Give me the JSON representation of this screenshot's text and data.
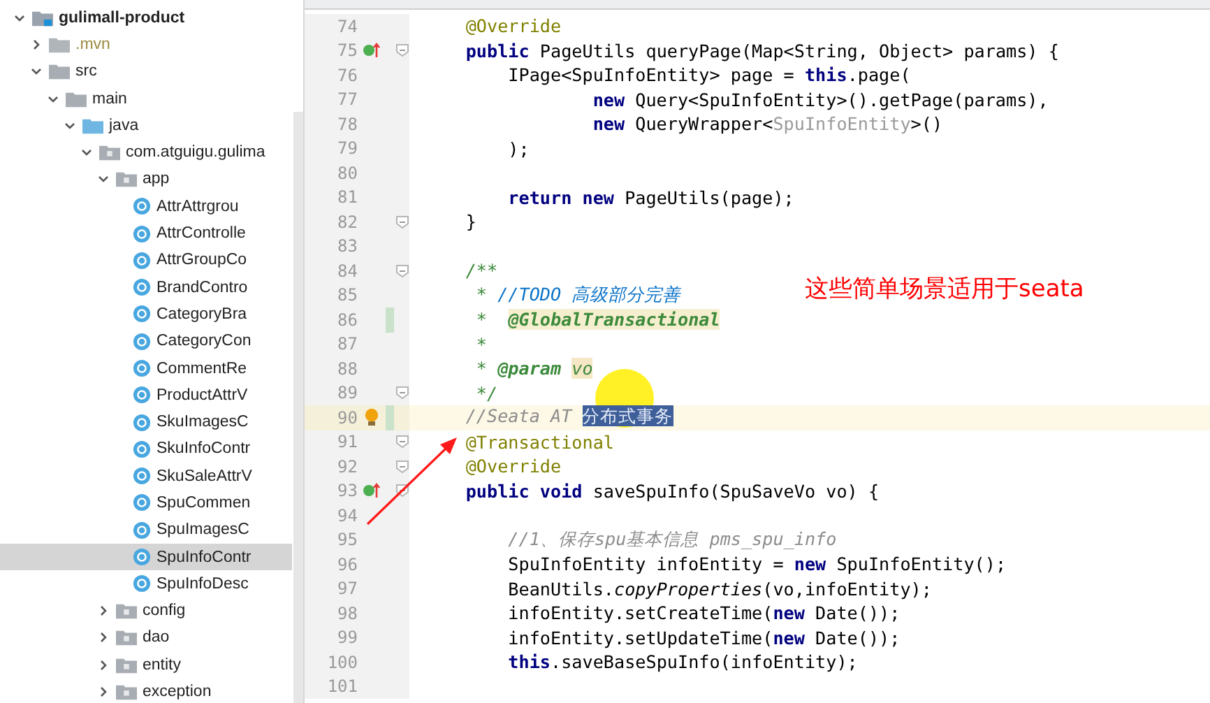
{
  "project_tree": {
    "items": [
      {
        "label": "gulimall-product",
        "kind": "module",
        "expanded": true,
        "selected": false,
        "children": [
          {
            "label": ".mvn",
            "kind": "excluded",
            "expanded": false,
            "selected": false
          },
          {
            "label": "src",
            "kind": "folder",
            "expanded": true,
            "selected": false,
            "children": [
              {
                "label": "main",
                "kind": "folder",
                "expanded": true,
                "selected": false,
                "children": [
                  {
                    "label": "java",
                    "kind": "source",
                    "expanded": true,
                    "selected": false,
                    "children": [
                      {
                        "label": "com.atguigu.gulima",
                        "kind": "package",
                        "expanded": true,
                        "selected": false,
                        "children": [
                          {
                            "label": "app",
                            "kind": "package",
                            "expanded": true,
                            "selected": false,
                            "children": [
                              {
                                "label": "AttrAttrgrou",
                                "kind": "class",
                                "selected": false
                              },
                              {
                                "label": "AttrControlle",
                                "kind": "class",
                                "selected": false
                              },
                              {
                                "label": "AttrGroupCo",
                                "kind": "class",
                                "selected": false
                              },
                              {
                                "label": "BrandContro",
                                "kind": "class",
                                "selected": false
                              },
                              {
                                "label": "CategoryBra",
                                "kind": "class",
                                "selected": false
                              },
                              {
                                "label": "CategoryCon",
                                "kind": "class",
                                "selected": false
                              },
                              {
                                "label": "CommentRe",
                                "kind": "class",
                                "selected": false
                              },
                              {
                                "label": "ProductAttrV",
                                "kind": "class",
                                "selected": false
                              },
                              {
                                "label": "SkuImagesC",
                                "kind": "class",
                                "selected": false
                              },
                              {
                                "label": "SkuInfoContr",
                                "kind": "class",
                                "selected": false
                              },
                              {
                                "label": "SkuSaleAttrV",
                                "kind": "class",
                                "selected": false
                              },
                              {
                                "label": "SpuCommen",
                                "kind": "class",
                                "selected": false
                              },
                              {
                                "label": "SpuImagesC",
                                "kind": "class",
                                "selected": false
                              },
                              {
                                "label": "SpuInfoContr",
                                "kind": "class",
                                "selected": true
                              },
                              {
                                "label": "SpuInfoDesc",
                                "kind": "class",
                                "selected": false
                              }
                            ]
                          },
                          {
                            "label": "config",
                            "kind": "package",
                            "expanded": false,
                            "selected": false
                          },
                          {
                            "label": "dao",
                            "kind": "package",
                            "expanded": false,
                            "selected": false
                          },
                          {
                            "label": "entity",
                            "kind": "package",
                            "expanded": false,
                            "selected": false
                          },
                          {
                            "label": "exception",
                            "kind": "package",
                            "expanded": false,
                            "selected": false
                          }
                        ]
                      }
                    ]
                  }
                ]
              }
            ]
          }
        ]
      }
    ]
  },
  "editor": {
    "lines": [
      {
        "number": "74",
        "overrides": false,
        "hint": false,
        "fold": false,
        "changed": false,
        "current": false,
        "tokens": [
          {
            "text": "    @Override",
            "kind": "annotation"
          }
        ]
      },
      {
        "number": "75",
        "overrides": true,
        "hint": false,
        "fold": true,
        "changed": false,
        "current": false,
        "tokens": [
          {
            "text": "    public",
            "kind": "keyword"
          },
          {
            "text": " PageUtils queryPage(Map<String, Object> params) {",
            "kind": "plain"
          }
        ]
      },
      {
        "number": "76",
        "overrides": false,
        "hint": false,
        "fold": false,
        "changed": false,
        "current": false,
        "tokens": [
          {
            "text": "        IPage<SpuInfoEntity> page = ",
            "kind": "plain"
          },
          {
            "text": "this",
            "kind": "keyword"
          },
          {
            "text": ".page(",
            "kind": "plain"
          }
        ]
      },
      {
        "number": "77",
        "overrides": false,
        "hint": false,
        "fold": false,
        "changed": false,
        "current": false,
        "tokens": [
          {
            "text": "                new",
            "kind": "keyword"
          },
          {
            "text": " Query<SpuInfoEntity>().getPage(params),",
            "kind": "plain"
          }
        ]
      },
      {
        "number": "78",
        "overrides": false,
        "hint": false,
        "fold": false,
        "changed": false,
        "current": false,
        "tokens": [
          {
            "text": "                new",
            "kind": "keyword"
          },
          {
            "text": " QueryWrapper<",
            "kind": "plain"
          },
          {
            "text": "SpuInfoEntity",
            "kind": "generic"
          },
          {
            "text": ">()",
            "kind": "plain"
          }
        ]
      },
      {
        "number": "79",
        "overrides": false,
        "hint": false,
        "fold": false,
        "changed": false,
        "current": false,
        "tokens": [
          {
            "text": "        );",
            "kind": "plain"
          }
        ]
      },
      {
        "number": "80",
        "overrides": false,
        "hint": false,
        "fold": false,
        "changed": false,
        "current": false
      },
      {
        "number": "81",
        "overrides": false,
        "hint": false,
        "fold": false,
        "changed": false,
        "current": false,
        "tokens": [
          {
            "text": "        return new",
            "kind": "keyword"
          },
          {
            "text": " PageUtils(page);",
            "kind": "plain"
          }
        ]
      },
      {
        "number": "82",
        "overrides": false,
        "hint": false,
        "fold": true,
        "changed": false,
        "current": false,
        "tokens": [
          {
            "text": "    }",
            "kind": "plain"
          }
        ]
      },
      {
        "number": "83",
        "overrides": false,
        "hint": false,
        "fold": false,
        "changed": false,
        "current": false
      },
      {
        "number": "84",
        "overrides": false,
        "hint": false,
        "fold": true,
        "changed": false,
        "current": false,
        "tokens": [
          {
            "text": "    /**",
            "kind": "doc"
          }
        ]
      },
      {
        "number": "85",
        "overrides": false,
        "hint": false,
        "fold": false,
        "changed": false,
        "current": false,
        "tokens": [
          {
            "text": "     * ",
            "kind": "doc"
          },
          {
            "text": "//TODO 高级部分完善",
            "kind": "todo"
          }
        ]
      },
      {
        "number": "86",
        "overrides": false,
        "hint": false,
        "fold": false,
        "changed": true,
        "current": false,
        "tokens": [
          {
            "text": "     *  ",
            "kind": "doc"
          },
          {
            "text": "@GlobalTransactional",
            "kind": "doc-marked"
          }
        ]
      },
      {
        "number": "87",
        "overrides": false,
        "hint": false,
        "fold": false,
        "changed": false,
        "current": false,
        "tokens": [
          {
            "text": "     *",
            "kind": "doc"
          }
        ]
      },
      {
        "number": "88",
        "overrides": false,
        "hint": false,
        "fold": false,
        "changed": false,
        "current": false,
        "tokens": [
          {
            "text": "     * ",
            "kind": "doc"
          },
          {
            "text": "@param ",
            "kind": "doc-tag"
          },
          {
            "text": "vo",
            "kind": "doc-value"
          }
        ]
      },
      {
        "number": "89",
        "overrides": false,
        "hint": false,
        "fold": true,
        "changed": false,
        "current": false,
        "tokens": [
          {
            "text": "     */",
            "kind": "doc"
          }
        ]
      },
      {
        "number": "90",
        "overrides": false,
        "hint": true,
        "fold": false,
        "changed": true,
        "current": true,
        "tokens": [
          {
            "text": "    //Seata AT ",
            "kind": "comment"
          },
          {
            "text": "分布式事务",
            "kind": "selected"
          }
        ]
      },
      {
        "number": "91",
        "overrides": false,
        "hint": false,
        "fold": true,
        "changed": false,
        "current": false,
        "tokens": [
          {
            "text": "    @Transactional",
            "kind": "annotation"
          }
        ]
      },
      {
        "number": "92",
        "overrides": false,
        "hint": false,
        "fold": true,
        "changed": false,
        "current": false,
        "tokens": [
          {
            "text": "    @Override",
            "kind": "annotation"
          }
        ]
      },
      {
        "number": "93",
        "overrides": true,
        "hint": false,
        "fold": true,
        "changed": false,
        "current": false,
        "tokens": [
          {
            "text": "    public void",
            "kind": "keyword"
          },
          {
            "text": " saveSpuInfo(SpuSaveVo vo) {",
            "kind": "plain"
          }
        ]
      },
      {
        "number": "94",
        "overrides": false,
        "hint": false,
        "fold": false,
        "changed": false,
        "current": false
      },
      {
        "number": "95",
        "overrides": false,
        "hint": false,
        "fold": false,
        "changed": false,
        "current": false,
        "tokens": [
          {
            "text": "        //1、保存spu基本信息 pms_spu_info",
            "kind": "comment"
          }
        ]
      },
      {
        "number": "96",
        "overrides": false,
        "hint": false,
        "fold": false,
        "changed": false,
        "current": false,
        "tokens": [
          {
            "text": "        SpuInfoEntity infoEntity = ",
            "kind": "plain"
          },
          {
            "text": "new",
            "kind": "keyword"
          },
          {
            "text": " SpuInfoEntity();",
            "kind": "plain"
          }
        ]
      },
      {
        "number": "97",
        "overrides": false,
        "hint": false,
        "fold": false,
        "changed": false,
        "current": false,
        "tokens": [
          {
            "text": "        BeanUtils.",
            "kind": "plain"
          },
          {
            "text": "copyProperties",
            "kind": "static"
          },
          {
            "text": "(vo,infoEntity);",
            "kind": "plain"
          }
        ]
      },
      {
        "number": "98",
        "overrides": false,
        "hint": false,
        "fold": false,
        "changed": false,
        "current": false,
        "tokens": [
          {
            "text": "        infoEntity.setCreateTime(",
            "kind": "plain"
          },
          {
            "text": "new",
            "kind": "keyword"
          },
          {
            "text": " Date());",
            "kind": "plain"
          }
        ]
      },
      {
        "number": "99",
        "overrides": false,
        "hint": false,
        "fold": false,
        "changed": false,
        "current": false,
        "tokens": [
          {
            "text": "        infoEntity.setUpdateTime(",
            "kind": "plain"
          },
          {
            "text": "new",
            "kind": "keyword"
          },
          {
            "text": " Date());",
            "kind": "plain"
          }
        ]
      },
      {
        "number": "100",
        "overrides": false,
        "hint": false,
        "fold": false,
        "changed": false,
        "current": false,
        "tokens": [
          {
            "text": "        this",
            "kind": "keyword"
          },
          {
            "text": ".saveBaseSpuInfo(infoEntity);",
            "kind": "plain"
          }
        ]
      },
      {
        "number": "101",
        "overrides": false,
        "hint": false,
        "fold": false,
        "changed": false,
        "current": false
      }
    ]
  },
  "annotation": {
    "text": "这些简单场景适用于seata"
  }
}
